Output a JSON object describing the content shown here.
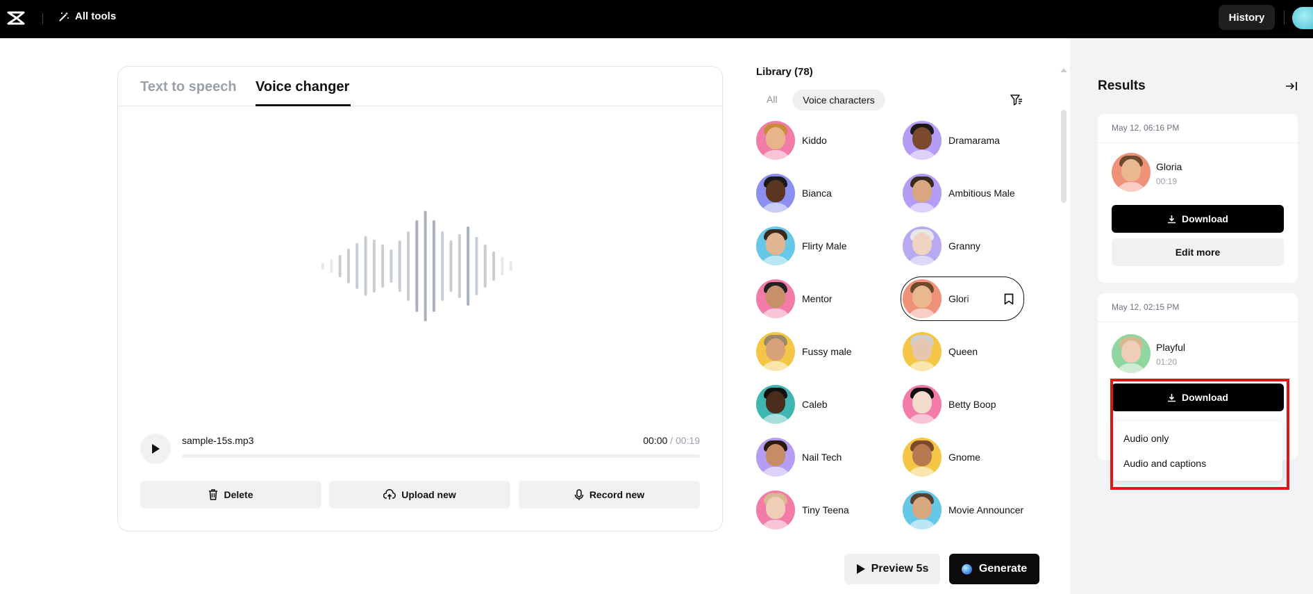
{
  "topbar": {
    "all_tools_label": "All tools",
    "history_label": "History"
  },
  "editor": {
    "tabs": [
      "Text to speech",
      "Voice changer"
    ],
    "active_tab": "Voice changer",
    "file_name": "sample-15s.mp3",
    "current_time": "00:00",
    "time_sep": " / ",
    "total_time": "00:19",
    "progress": 0,
    "actions": {
      "delete": "Delete",
      "upload": "Upload new",
      "record": "Record new"
    }
  },
  "library": {
    "title": "Library (78)",
    "filters": {
      "all": "All",
      "voice_characters": "Voice characters"
    },
    "voices": [
      {
        "name": "Kiddo",
        "bg": "#f27ba8"
      },
      {
        "name": "Dramarama",
        "bg": "#b59cf5"
      },
      {
        "name": "Bianca",
        "bg": "#8a8ff0"
      },
      {
        "name": "Ambitious Male",
        "bg": "#b59cf5"
      },
      {
        "name": "Flirty Male",
        "bg": "#67c7e8"
      },
      {
        "name": "Granny",
        "bg": "#b9a9f0"
      },
      {
        "name": "Mentor",
        "bg": "#f27ba8"
      },
      {
        "name": "Glori",
        "bg": "#f0917a",
        "selected": true
      },
      {
        "name": "Fussy male",
        "bg": "#f5c646"
      },
      {
        "name": "Queen",
        "bg": "#f5c646"
      },
      {
        "name": "Caleb",
        "bg": "#3fb6b0"
      },
      {
        "name": "Betty Boop",
        "bg": "#f27ba8"
      },
      {
        "name": "Nail Tech",
        "bg": "#b59cf5"
      },
      {
        "name": "Gnome",
        "bg": "#f5c646"
      },
      {
        "name": "Tiny Teena",
        "bg": "#f27ba8"
      },
      {
        "name": "Movie Announcer",
        "bg": "#67c7e8"
      }
    ],
    "preview_label": "Preview 5s",
    "generate_label": "Generate"
  },
  "results": {
    "title": "Results",
    "items": [
      {
        "date": "May 12, 06:16 PM",
        "name": "Gloria",
        "duration": "00:19",
        "download_label": "Download",
        "edit_label": "Edit more",
        "avatar_bg": "#f0917a"
      },
      {
        "date": "May 12, 02:15 PM",
        "name": "Playful",
        "duration": "01:20",
        "download_label": "Download",
        "avatar_bg": "#8fd6a0"
      }
    ],
    "download_menu": [
      "Audio only",
      "Audio and captions"
    ]
  },
  "colors": {
    "accent": "#000000",
    "highlight": "#e0151b"
  }
}
